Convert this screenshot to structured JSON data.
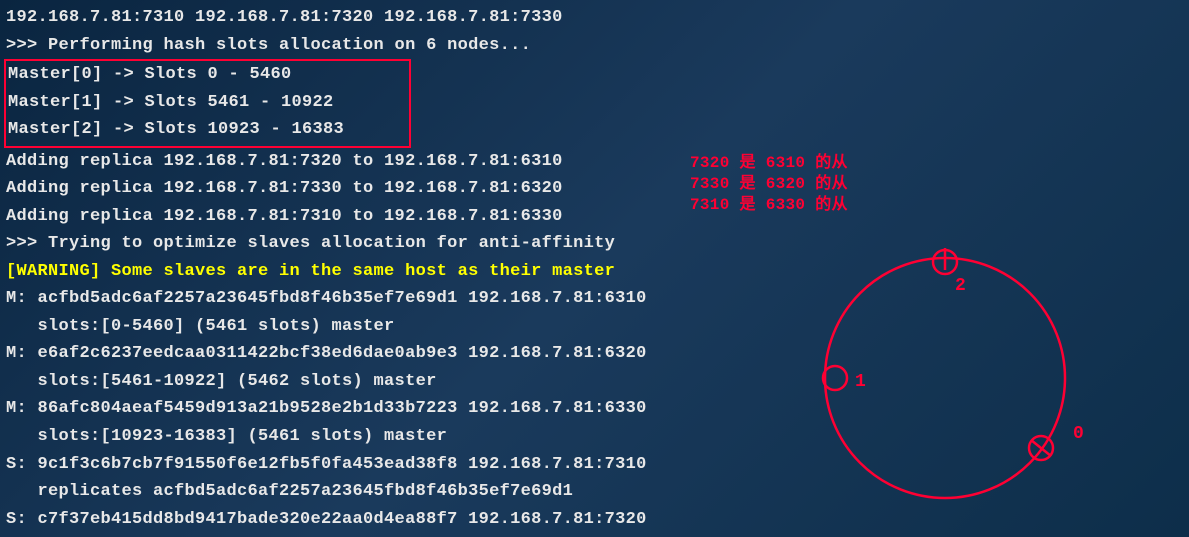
{
  "terminal": {
    "line0": "192.168.7.81:7310 192.168.7.81:7320 192.168.7.81:7330",
    "line1": ">>> Performing hash slots allocation on 6 nodes...",
    "boxed": {
      "l1": "Master[0] -> Slots 0 - 5460",
      "l2": "Master[1] -> Slots 5461 - 10922",
      "l3": "Master[2] -> Slots 10923 - 16383      "
    },
    "line5": "Adding replica 192.168.7.81:7320 to 192.168.7.81:6310",
    "line6": "Adding replica 192.168.7.81:7330 to 192.168.7.81:6320",
    "line7": "Adding replica 192.168.7.81:7310 to 192.168.7.81:6330",
    "line8": ">>> Trying to optimize slaves allocation for anti-affinity",
    "line9": "[WARNING] Some slaves are in the same host as their master",
    "line10": "M: acfbd5adc6af2257a23645fbd8f46b35ef7e69d1 192.168.7.81:6310",
    "line11": "   slots:[0-5460] (5461 slots) master",
    "line12": "M: e6af2c6237eedcaa0311422bcf38ed6dae0ab9e3 192.168.7.81:6320",
    "line13": "   slots:[5461-10922] (5462 slots) master",
    "line14": "M: 86afc804aeaf5459d913a21b9528e2b1d33b7223 192.168.7.81:6330",
    "line15": "   slots:[10923-16383] (5461 slots) master",
    "line16": "S: 9c1f3c6b7cb7f91550f6e12fb5f0fa453ead38f8 192.168.7.81:7310",
    "line17": "   replicates acfbd5adc6af2257a23645fbd8f46b35ef7e69d1",
    "line18": "S: c7f37eb415dd8bd9417bade320e22aa0d4ea88f7 192.168.7.81:7320"
  },
  "annotations": {
    "a1": "7320 是 6310 的从",
    "a2": "7330 是 6320 的从",
    "a3": "7310 是 6330 的从"
  },
  "ring": {
    "label0": "0",
    "label1": "1",
    "label2": "2"
  }
}
